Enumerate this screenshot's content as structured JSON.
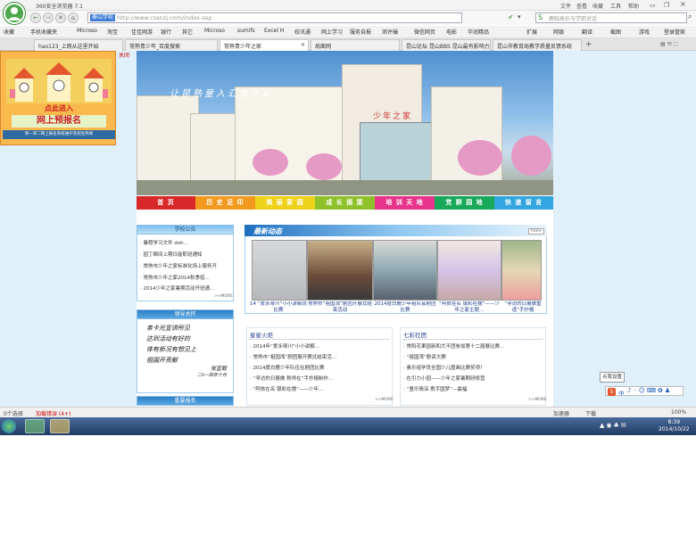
{
  "browser": {
    "title": "360安全浏览器 7.1",
    "window_menu": [
      "文件",
      "查看",
      "收藏",
      "工具",
      "帮助"
    ],
    "address_label": "泰山学校",
    "url": "http://www.cssnzj.com/index.asp",
    "search_placeholder": "鹿晗高价与学职对话",
    "bookmarks": [
      "收藏",
      "手机收藏夹",
      "Microso",
      "淘宝",
      "佳佳网游",
      "银行",
      "其它",
      "Microso",
      "sumifs",
      "Excel H",
      "校讯通",
      "网上学习",
      "服务自报",
      "测评撮",
      "微信网页",
      "电影",
      "华润精品",
      "扩展",
      "网银",
      "翻译",
      "截图",
      "游戏",
      "登录管家"
    ],
    "tabs": [
      {
        "label": "hao123_上网从这里开始"
      },
      {
        "label": "常熟青少年_百度搜索"
      },
      {
        "label": "常熟青少年之家"
      },
      {
        "label": "局面网"
      },
      {
        "label": "昆山论坛 昆山BBS 昆山最有影响力"
      },
      {
        "label": "昆山市教育局教学质量反馈系统"
      }
    ],
    "close_tab": "×",
    "new_tab": "+"
  },
  "ad": {
    "line1": "点此进入",
    "line2": "网上预报名",
    "line3": "周一周二网上报名系统维护及招生简章",
    "close": "关闭"
  },
  "site": {
    "banner_calligraphy": "让昆熟童入汇爱光彩",
    "banner_sign": "少年之家",
    "menu": [
      {
        "label": "首 页",
        "color": "#d8282a"
      },
      {
        "label": "历 史 足 印",
        "color": "#f29a1e"
      },
      {
        "label": "美 丽 家 园",
        "color": "#efd21a"
      },
      {
        "label": "成 长 摇 篮",
        "color": "#8fc22a"
      },
      {
        "label": "培 训 天 地",
        "color": "#e8338a"
      },
      {
        "label": "党 群 园 地",
        "color": "#18a85a"
      },
      {
        "label": "快 速 留 言",
        "color": "#33a5df"
      }
    ],
    "notice": {
      "title": "学校公告",
      "items": [
        "暑假学习文件 doh...",
        "园丁瞬间上期日能职班通知",
        "常熟市少年之家标准化场上服务开",
        "常熟市少年之家2014秋季招...",
        "2014少年之家暑期活动开班通..."
      ],
      "more": ">>MORE"
    },
    "leader": {
      "title": "领导关怀",
      "handwriting_lines": [
        "亲卡光宣讲所见",
        "达到活动有好的",
        "体有新况有想见上",
        "祖国开贡献",
        "张宣毅",
        "二0一四年十月"
      ]
    },
    "next_panel": "重要报名",
    "news": {
      "title": "最新动态",
      "more": "more",
      "captions": [
        "14 “爱永琴川”小小讲解员比赛",
        "常熟市“祖国湾”剧团开展式结束活动",
        "2014度白鹿少年组队会剧团比赛",
        "“阿依在名 银彩在摆”——少年之家主题…",
        "“寻访的日展做重谊”手抄报"
      ]
    },
    "col1": {
      "title": "星星火炬",
      "items": [
        "2014年“爱永琴川”小小讲解…",
        "常熟市“祖国湾”剧团展开赛式结束活…",
        "2014度白鹿少年队伍在剧团比赛",
        "“寻访的日展做 穆师在”手抄报制作…",
        "“阿依在名 银彩在摆”——少年…"
      ],
      "more": ">>MORE"
    },
    "col2": {
      "title": "七彩社团",
      "items": [
        "常阳花果园新和犬不团参加第十二届展比赛…",
        "“祖国湾”剧读大赛",
        "素乐组学员全国少儿图画比赛奖项！",
        "在引力小园——少年之家暑期研修营",
        "“童乐情深 携手国梦”—最福"
      ],
      "more": ">>MORE"
    }
  },
  "popup": {
    "label": "点我设置"
  },
  "sogou": {
    "label": "中"
  },
  "status": {
    "left1": "0个选择",
    "left2": "加载错误 (4+)",
    "right1": "加速器",
    "right2": "下载",
    "right3": "100%"
  },
  "taskbar": {
    "time": "8:39",
    "date": "2014/10/22"
  }
}
